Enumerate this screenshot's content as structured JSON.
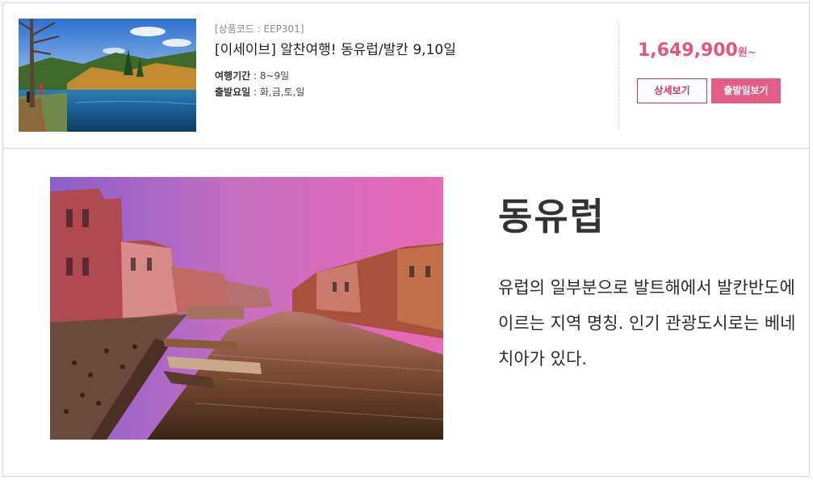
{
  "product": {
    "code": "[상품코드 : EEP301]",
    "title": "[이세이브] 알찬여행! 동유럽/발칸 9,10일",
    "duration_label": "여행기간",
    "duration_value": " : 8~9일",
    "departure_label": "출발요일",
    "departure_value": " : 화,금,토,일",
    "price": "1,649,900",
    "price_unit": "원~",
    "detail_button": "상세보기",
    "dates_button": "출발일보기",
    "colors": {
      "accent": "#e45d86",
      "price": "#e5547a"
    }
  },
  "region": {
    "title": "동유럽",
    "description": "유럽의 일부분으로 발트해에서 발칸반도에 이르는 지역 명칭. 인기 관광도시로는 베네치아가 있다."
  }
}
